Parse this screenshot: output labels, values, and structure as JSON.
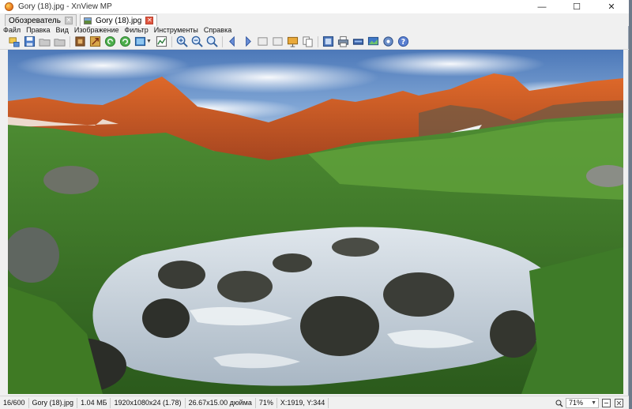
{
  "window": {
    "title": "Gory (18).jpg - XnView MP"
  },
  "window_controls": {
    "minimize": "—",
    "maximize": "☐",
    "close": "✕"
  },
  "tabs": [
    {
      "label": "Обозреватель",
      "close": "✕"
    },
    {
      "label": "Gory (18).jpg",
      "close": "✕"
    }
  ],
  "menu": [
    "Файл",
    "Правка",
    "Вид",
    "Изображение",
    "Фильтр",
    "Инструменты",
    "Справка"
  ],
  "toolbar": {
    "icons": [
      "browser-icon",
      "save-icon",
      "previous-folder-icon",
      "next-folder-icon",
      "crop-icon",
      "resize-icon",
      "rotate-left-icon",
      "rotate-right-icon",
      "adjust-icon",
      "edit-icon",
      "zoom-in-icon",
      "zoom-out-icon",
      "zoom-fit-icon",
      "previous-image-icon",
      "next-image-icon",
      "first-image-icon",
      "last-image-icon",
      "slideshow-icon",
      "copy-icon",
      "fullscreen-icon",
      "print-icon",
      "scanner-icon",
      "wallpaper-icon",
      "settings-icon",
      "help-icon"
    ]
  },
  "viewer": {
    "image_description_icon": "landscape-photo"
  },
  "status": {
    "index": "16/600",
    "filename": "Gory (18).jpg",
    "filesize": "1.04 МБ",
    "dimensions": "1920x1080x24 (1.78)",
    "print_size": "26.67x15.00 дюйма",
    "zoom_percent": "71%",
    "cursor": "X:1919, Y:344",
    "zoom_value": "71%"
  },
  "colors": {
    "accent_orange": "#e8731b",
    "tab_close_red": "#e0553f"
  }
}
